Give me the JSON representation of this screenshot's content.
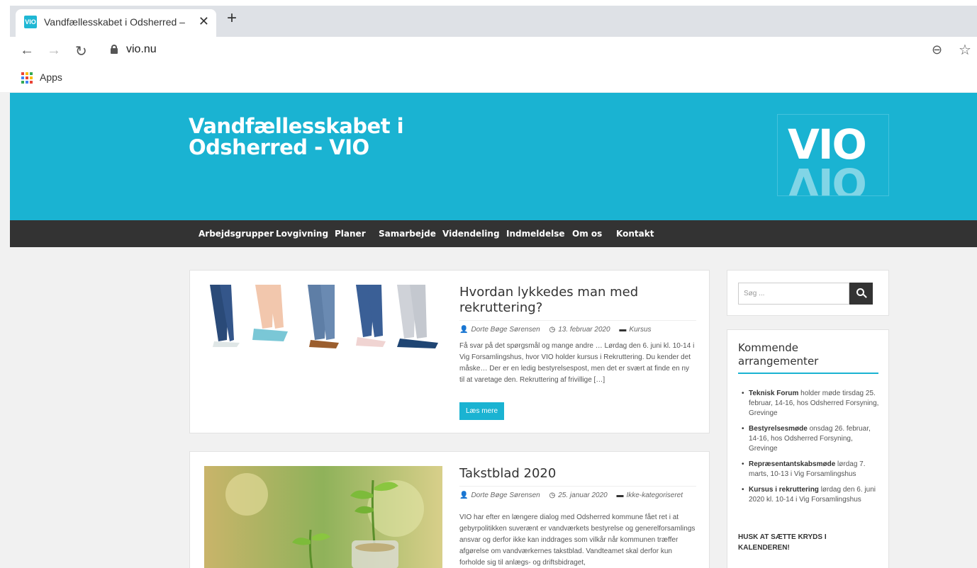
{
  "browser": {
    "tab_title": "Vandfællesskabet i Odsherred – V",
    "tab_favicon": "VIO",
    "url": "vio.nu",
    "bookmarks_apps": "Apps"
  },
  "site": {
    "title": "Vandfællesskabet i Odsherred - VIO",
    "logo_text": "VIO"
  },
  "nav": [
    "Arbejdsgrupper",
    "Lovgivning",
    "Planer",
    "Samarbejde",
    "Videndeling",
    "Indmeldelse",
    "Om os",
    "Kontakt"
  ],
  "posts": [
    {
      "title": "Hvordan lykkedes man med rekruttering?",
      "author": "Dorte Bøge Sørensen",
      "date": "13. februar 2020",
      "category": "Kursus",
      "excerpt": "Få svar på det spørgsmål og mange andre … Lørdag den 6. juni kl. 10-14 i Vig Forsamlingshus, hvor VIO holder kursus i Rekruttering. Du kender det måske… Der er en ledig bestyrelsespost, men det er svært at finde en ny til at varetage den. Rekruttering af frivillige […]",
      "read_more": "Læs mere"
    },
    {
      "title": "Takstblad 2020",
      "author": "Dorte Bøge Sørensen",
      "date": "25. januar 2020",
      "category": "Ikke-kategoriseret",
      "excerpt": "VIO har efter en længere dialog med Odsherred kommune fået ret i at gebyrpolitikken suverænt er vandværkets bestyrelse og generelforsamlings ansvar og derfor ikke kan inddrages som vilkår når kommunen træffer afgørelse om vandværkernes takstblad. Vandteamet skal derfor kun forholde sig til anlægs- og driftsbidraget,"
    }
  ],
  "sidebar": {
    "search_placeholder": "Søg ...",
    "events_title": "Kommende arrangementer",
    "events": [
      {
        "bold": "Teknisk Forum",
        "rest": " holder møde tirsdag 25. februar, 14-16, hos Odsherred Forsyning, Grevinge"
      },
      {
        "bold": "Bestyrelsesmøde",
        "rest": " onsdag 26. februar, 14-16, hos Odsherred Forsyning, Grevinge"
      },
      {
        "bold": "Repræsentantskabsmøde",
        "rest": " lørdag 7. marts, 10-13 i Vig Forsamlingshus"
      },
      {
        "bold": "Kursus i rekruttering",
        "rest": " lørdag den 6. juni 2020 kl. 10-14 i Vig Forsamlingshus"
      }
    ],
    "note": "HUSK AT SÆTTE KRYDS I KALENDEREN!"
  }
}
